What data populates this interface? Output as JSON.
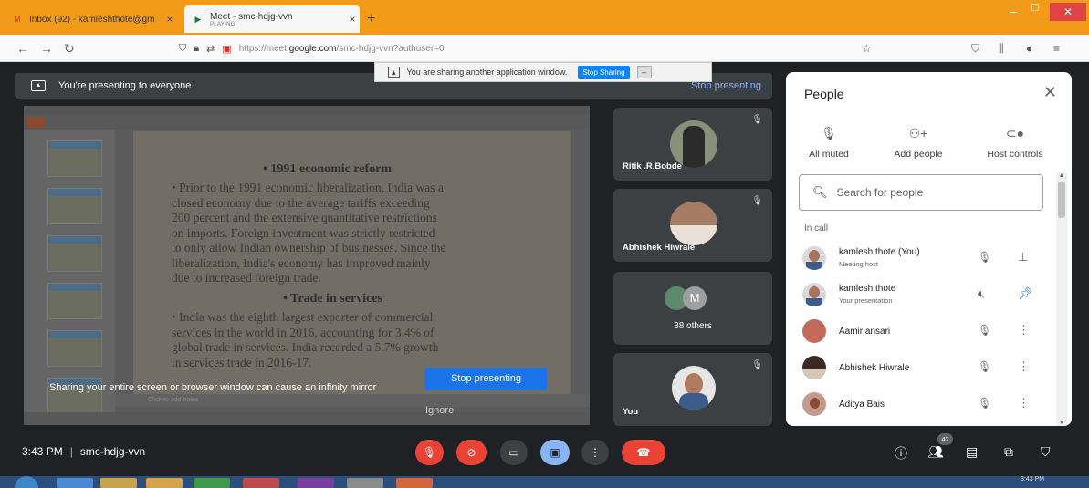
{
  "browser": {
    "tabs": [
      {
        "title": "Inbox (92) - kamleshthote@gm",
        "icon": "gmail-icon"
      },
      {
        "title": "Meet - smc-hdjg-vvn",
        "subtitle": "PLAYING",
        "icon": "meet-icon"
      }
    ],
    "url_prefix": "https://meet.",
    "url_domain": "google.com",
    "url_suffix": "/smc-hdjg-vvn?authuser=0"
  },
  "share_notification": {
    "text": "You are sharing another application window.",
    "stop_label": "Stop Sharing"
  },
  "presenting_bar": {
    "text": "You're presenting to everyone",
    "stop_link": "Stop presenting"
  },
  "slide": {
    "heading1": "• 1991 economic reform",
    "body1_line1": "• Prior to the 1991 economic liberalization, India was a",
    "body1_line2": "closed economy due to the average tariffs exceeding",
    "body1_line3": "200 percent and the extensive quantitative restrictions",
    "body1_line4": "on imports. Foreign investment was strictly restricted",
    "body1_line5": "to only allow Indian ownership of businesses. Since the",
    "body1_line6": "liberalization, India's economy has improved mainly",
    "body1_line7": "due to increased foreign trade.",
    "heading2": "• Trade in services",
    "body2_line1": "• India was the eighth largest exporter of commercial",
    "body2_line2": "services in the world in 2016, accounting for 3.4% of",
    "body2_line3": "global trade in services. India recorded a 5.7% growth",
    "body2_line4": "in services trade in 2016-17.",
    "notes_placeholder": "Click to add notes"
  },
  "warning": {
    "text": "Sharing your entire screen or browser window can cause an infinity mirror",
    "stop_btn": "Stop presenting",
    "ignore_btn": "Ignore"
  },
  "tiles": [
    {
      "name": "Ritik .R.Bobde"
    },
    {
      "name": "Abhishek Hiwrale"
    },
    {
      "name": "38 others",
      "initial": "M"
    },
    {
      "name": "You"
    }
  ],
  "people": {
    "title": "People",
    "actions": [
      "All muted",
      "Add people",
      "Host controls"
    ],
    "search_placeholder": "Search for people",
    "section_label": "In call",
    "participants": [
      {
        "name": "kamlesh thote (You)",
        "sub": "Meeting host"
      },
      {
        "name": "kamlesh thote",
        "sub": "Your presentation"
      },
      {
        "name": "Aamir ansari",
        "sub": ""
      },
      {
        "name": "Abhishek Hiwrale",
        "sub": ""
      },
      {
        "name": "Aditya Bais",
        "sub": ""
      }
    ]
  },
  "controls": {
    "time": "3:43 PM",
    "meeting_code": "smc-hdjg-vvn",
    "people_count": "42"
  },
  "taskbar": {
    "clock": "3:43 PM"
  },
  "colors": {
    "accent_blue": "#1a73e8",
    "leave_red": "#ea4335",
    "tab_orange": "#f29b1b",
    "meet_dark": "#202124"
  }
}
